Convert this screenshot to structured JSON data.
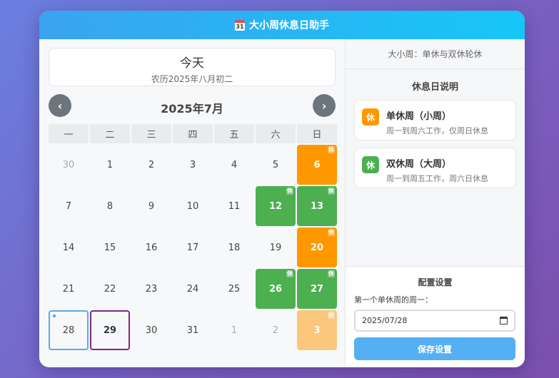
{
  "header": {
    "icon_day": "31",
    "title": "大小周休息日助手"
  },
  "today": {
    "title": "今天",
    "lunar": "农历2025年八月初二"
  },
  "calendar": {
    "prev": "‹",
    "next": "›",
    "month_title": "2025年7月",
    "weekdays": [
      "一",
      "二",
      "三",
      "四",
      "五",
      "六",
      "日"
    ],
    "rest_badge": "休",
    "days": [
      {
        "n": "30",
        "s": "other"
      },
      {
        "n": "1",
        "s": ""
      },
      {
        "n": "2",
        "s": ""
      },
      {
        "n": "3",
        "s": ""
      },
      {
        "n": "4",
        "s": ""
      },
      {
        "n": "5",
        "s": ""
      },
      {
        "n": "6",
        "s": "single"
      },
      {
        "n": "7",
        "s": ""
      },
      {
        "n": "8",
        "s": ""
      },
      {
        "n": "9",
        "s": ""
      },
      {
        "n": "10",
        "s": ""
      },
      {
        "n": "11",
        "s": ""
      },
      {
        "n": "12",
        "s": "double"
      },
      {
        "n": "13",
        "s": "double"
      },
      {
        "n": "14",
        "s": ""
      },
      {
        "n": "15",
        "s": ""
      },
      {
        "n": "16",
        "s": ""
      },
      {
        "n": "17",
        "s": ""
      },
      {
        "n": "18",
        "s": ""
      },
      {
        "n": "19",
        "s": ""
      },
      {
        "n": "20",
        "s": "single"
      },
      {
        "n": "21",
        "s": ""
      },
      {
        "n": "22",
        "s": ""
      },
      {
        "n": "23",
        "s": ""
      },
      {
        "n": "24",
        "s": ""
      },
      {
        "n": "25",
        "s": ""
      },
      {
        "n": "26",
        "s": "double"
      },
      {
        "n": "27",
        "s": "double"
      },
      {
        "n": "28",
        "s": "today"
      },
      {
        "n": "29",
        "s": "selected"
      },
      {
        "n": "30",
        "s": ""
      },
      {
        "n": "31",
        "s": ""
      },
      {
        "n": "1",
        "s": "other"
      },
      {
        "n": "2",
        "s": "other"
      },
      {
        "n": "3",
        "s": "single-fade"
      }
    ]
  },
  "sidebar": {
    "rule_label": "大小周：单休与双休轮休",
    "legend_title": "休息日说明",
    "legend": [
      {
        "icon": "休",
        "name": "单休周（小周）",
        "desc": "周一到周六工作，仅周日休息",
        "color": "#ff9800"
      },
      {
        "icon": "休",
        "name": "双休周（大周）",
        "desc": "周一到周五工作，周六日休息",
        "color": "#4caf50"
      }
    ],
    "config": {
      "title": "配置设置",
      "label": "第一个单休周的周一：",
      "date_value": "2025/07/28",
      "save_label": "保存设置"
    }
  },
  "colors": {
    "single": "#ff9800",
    "double": "#4caf50",
    "header": "#16c6f8",
    "save": "#54aff5"
  }
}
